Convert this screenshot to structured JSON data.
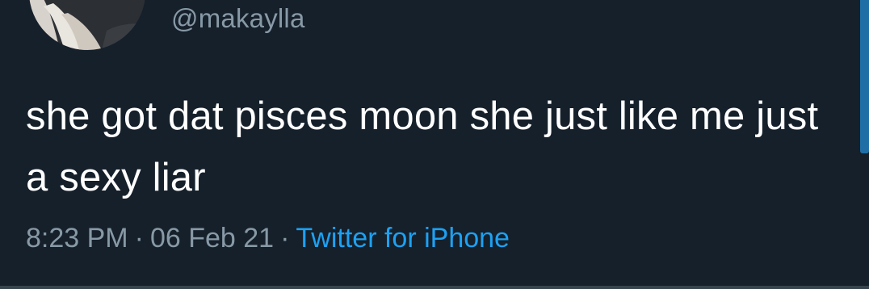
{
  "tweet": {
    "handle": "@makaylla",
    "text": "she got dat pisces moon she just like me just a sexy liar",
    "time": "8:23 PM",
    "separator": "·",
    "date": "06 Feb 21",
    "source": "Twitter for iPhone"
  },
  "colors": {
    "background": "#15202b",
    "secondary_text": "#8899a6",
    "link": "#1da1f2"
  }
}
